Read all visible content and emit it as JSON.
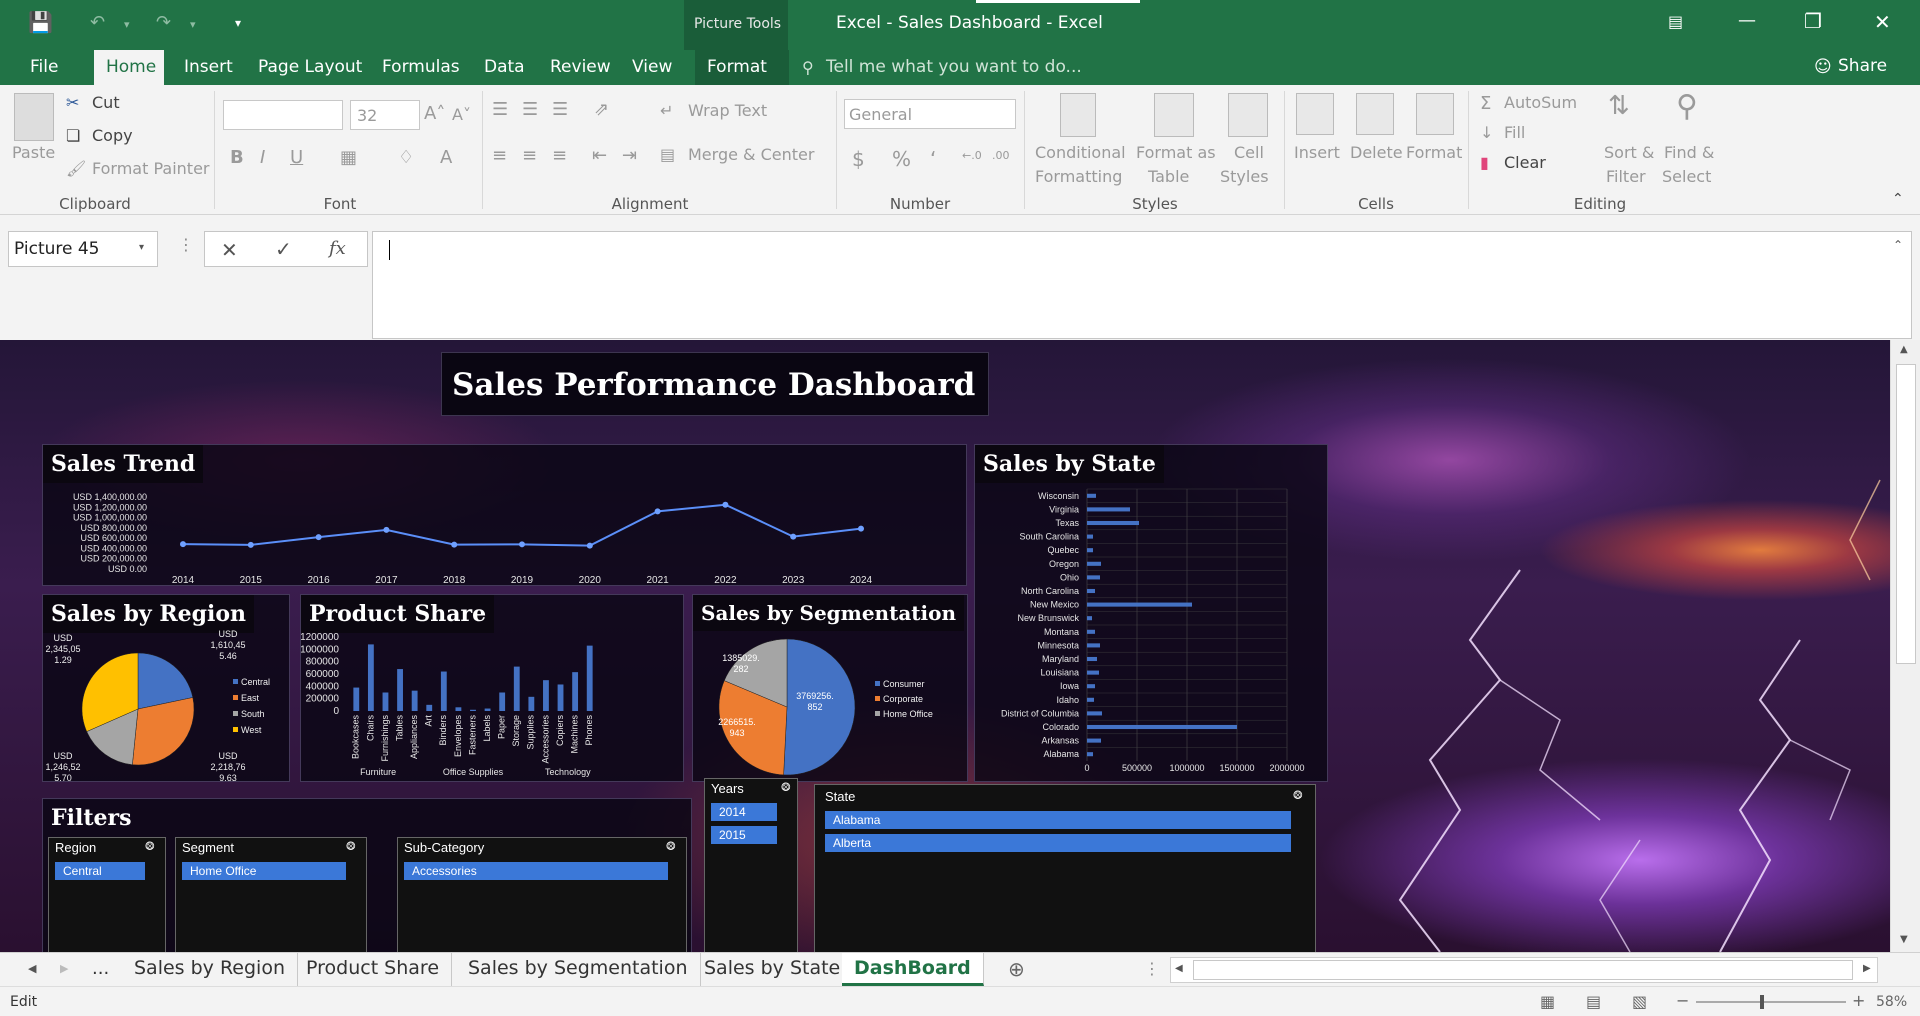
{
  "window": {
    "title": "Excel - Sales Dashboard - Excel",
    "context_tab_group": "Picture Tools",
    "minimize": "—",
    "restore": "❐",
    "close": "✕"
  },
  "ribbon_tabs": [
    "File",
    "Home",
    "Insert",
    "Page Layout",
    "Formulas",
    "Data",
    "Review",
    "View",
    "Format"
  ],
  "tell_me": "Tell me what you want to do...",
  "share": "Share",
  "ribbon": {
    "clipboard": {
      "paste": "Paste",
      "cut": "Cut",
      "copy": "Copy",
      "format_painter": "Format Painter",
      "label": "Clipboard"
    },
    "font": {
      "size": "32",
      "label": "Font"
    },
    "alignment": {
      "wrap": "Wrap Text",
      "merge": "Merge & Center",
      "label": "Alignment"
    },
    "number": {
      "format": "General",
      "label": "Number"
    },
    "styles": {
      "cond1": "Conditional",
      "cond2": "Formatting",
      "fmt1": "Format as",
      "fmt2": "Table",
      "cell1": "Cell",
      "cell2": "Styles",
      "label": "Styles"
    },
    "cells": {
      "insert": "Insert",
      "delete": "Delete",
      "format": "Format",
      "label": "Cells"
    },
    "editing": {
      "autosum": "AutoSum",
      "fill": "Fill",
      "clear": "Clear",
      "sort1": "Sort &",
      "sort2": "Filter",
      "find1": "Find &",
      "find2": "Select",
      "label": "Editing"
    }
  },
  "name_box": "Picture 45",
  "dashboard": {
    "title": "Sales Performance Dashboard",
    "trend_title": "Sales Trend",
    "region_title": "Sales by Region",
    "product_title": "Product Share",
    "segment_title": "Sales by Segmentation",
    "state_title": "Sales by State",
    "filters_title": "Filters",
    "slicers": {
      "region": {
        "label": "Region",
        "item": "Central"
      },
      "segment": {
        "label": "Segment",
        "item": "Home Office"
      },
      "subcat": {
        "label": "Sub-Category",
        "item": "Accessories"
      },
      "years": {
        "label": "Years",
        "items": [
          "2014",
          "2015"
        ]
      },
      "state": {
        "label": "State",
        "items": [
          "Alabama",
          "Alberta"
        ]
      }
    }
  },
  "chart_data": [
    {
      "type": "line",
      "title": "Sales Trend",
      "x": [
        "2014",
        "2015",
        "2016",
        "2017",
        "2018",
        "2019",
        "2020",
        "2021",
        "2022",
        "2023",
        "2024"
      ],
      "values": [
        484000,
        470000,
        620000,
        760000,
        475000,
        480000,
        455000,
        1120000,
        1250000,
        630000,
        785000
      ],
      "y_ticks": [
        "USD 0.00",
        "USD 200,000.00",
        "USD 400,000.00",
        "USD 600,000.00",
        "USD 800,000.00",
        "USD 1,000,000.00",
        "USD 1,200,000.00",
        "USD 1,400,000.00"
      ],
      "ylim": [
        0,
        1400000
      ]
    },
    {
      "type": "pie",
      "title": "Sales by Region",
      "categories": [
        "Central",
        "East",
        "South",
        "West"
      ],
      "values": [
        1610455.46,
        2218769.63,
        1246525.7,
        2345051.29
      ],
      "labels": [
        "USD 1,610,45 5.46",
        "USD 2,218,76 9.63",
        "USD 1,246,52 5.70",
        "USD 2,345,05 1.29"
      ],
      "colors": [
        "#4472c4",
        "#ed7d31",
        "#a5a5a5",
        "#ffc000"
      ]
    },
    {
      "type": "bar",
      "title": "Product Share",
      "categories": [
        "Bookcases",
        "Chairs",
        "Furnishings",
        "Tables",
        "Appliances",
        "Art",
        "Binders",
        "Envelopes",
        "Fasteners",
        "Labels",
        "Paper",
        "Storage",
        "Supplies",
        "Accessories",
        "Copiers",
        "Machines",
        "Phones"
      ],
      "groups": [
        {
          "name": "Furniture",
          "count": 4
        },
        {
          "name": "Office Supplies",
          "count": 9
        },
        {
          "name": "Technology",
          "count": 4
        }
      ],
      "values": [
        380000,
        1080000,
        300000,
        680000,
        330000,
        100000,
        640000,
        60000,
        20000,
        40000,
        300000,
        720000,
        230000,
        500000,
        430000,
        630000,
        1060000
      ],
      "y_ticks": [
        "0",
        "200000",
        "400000",
        "600000",
        "800000",
        "1000000",
        "1200000"
      ],
      "ylim": [
        0,
        1200000
      ]
    },
    {
      "type": "pie",
      "title": "Sales by Segmentation",
      "categories": [
        "Consumer",
        "Corporate",
        "Home Office"
      ],
      "values": [
        3769256.852,
        2266515.943,
        1385029.282
      ],
      "labels": [
        "3769256. 852",
        "2266515. 943",
        "1385029. 282"
      ],
      "colors": [
        "#4472c4",
        "#ed7d31",
        "#a5a5a5"
      ]
    },
    {
      "type": "bar",
      "title": "Sales by State",
      "categories": [
        "Alabama",
        "Arkansas",
        "Colorado",
        "District of Columbia",
        "Idaho",
        "Iowa",
        "Louisiana",
        "Maryland",
        "Minnesota",
        "Montana",
        "New Brunswick",
        "New Mexico",
        "North Carolina",
        "Ohio",
        "Oregon",
        "Quebec",
        "South Carolina",
        "Texas",
        "Virginia",
        "Wisconsin"
      ],
      "values": [
        60000,
        140000,
        1500000,
        150000,
        70000,
        80000,
        120000,
        100000,
        130000,
        80000,
        50000,
        1050000,
        80000,
        130000,
        140000,
        60000,
        60000,
        520000,
        430000,
        90000
      ],
      "x_ticks": [
        "0",
        "500000",
        "1000000",
        "1500000",
        "2000000"
      ],
      "xlim": [
        0,
        2000000
      ]
    }
  ],
  "sheet_tabs": [
    "Sales by Region",
    "Product Share",
    "Sales by Segmentation",
    "Sales by State",
    "DashBoard"
  ],
  "sheet_dots": "...",
  "status": {
    "mode": "Edit",
    "zoom": "58%"
  }
}
